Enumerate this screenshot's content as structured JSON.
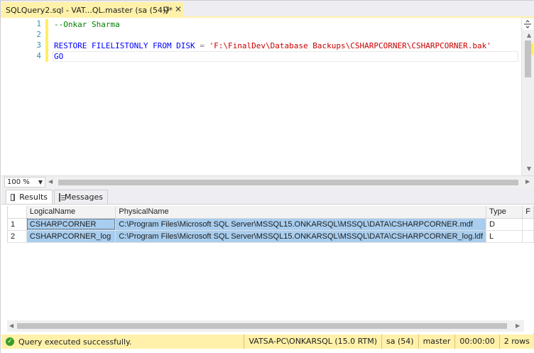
{
  "tab": {
    "title": "SQLQuery2.sql - VAT...QL.master (sa (54))*"
  },
  "editor": {
    "line_numbers": [
      "1",
      "2",
      "3",
      "4"
    ],
    "line1_comment": "--Onkar Sharma",
    "line3_kw": "RESTORE FILELISTONLY FROM DISK",
    "line3_op": "=",
    "line3_str": "'F:\\FinalDev\\Database Backups\\CSHARPCORNER\\CSHARPCORNER.bak'",
    "line4_kw": "GO"
  },
  "zoom": {
    "value": "100 %"
  },
  "results_tabs": {
    "results": "Results",
    "messages": "Messages"
  },
  "grid": {
    "columns": [
      "LogicalName",
      "PhysicalName",
      "Type",
      "F"
    ],
    "rows": [
      {
        "num": "1",
        "logical": "CSHARPCORNER",
        "physical": "C:\\Program Files\\Microsoft SQL Server\\MSSQL15.ONKARSQL\\MSSQL\\DATA\\CSHARPCORNER.mdf",
        "type": "D"
      },
      {
        "num": "2",
        "logical": "CSHARPCORNER_log",
        "physical": "C:\\Program Files\\Microsoft SQL Server\\MSSQL15.ONKARSQL\\MSSQL\\DATA\\CSHARPCORNER_log.ldf",
        "type": "L"
      }
    ]
  },
  "status": {
    "message": "Query executed successfully.",
    "server": "VATSA-PC\\ONKARSQL (15.0 RTM)",
    "user": "sa (54)",
    "database": "master",
    "elapsed": "00:00:00",
    "rows": "2 rows"
  },
  "colors": {
    "accent_yellow": "#fff1a9",
    "selection": "#a8cdee",
    "keyword": "#0000ff",
    "string": "#c80000",
    "comment": "#008000",
    "line_number": "#2b91af"
  }
}
